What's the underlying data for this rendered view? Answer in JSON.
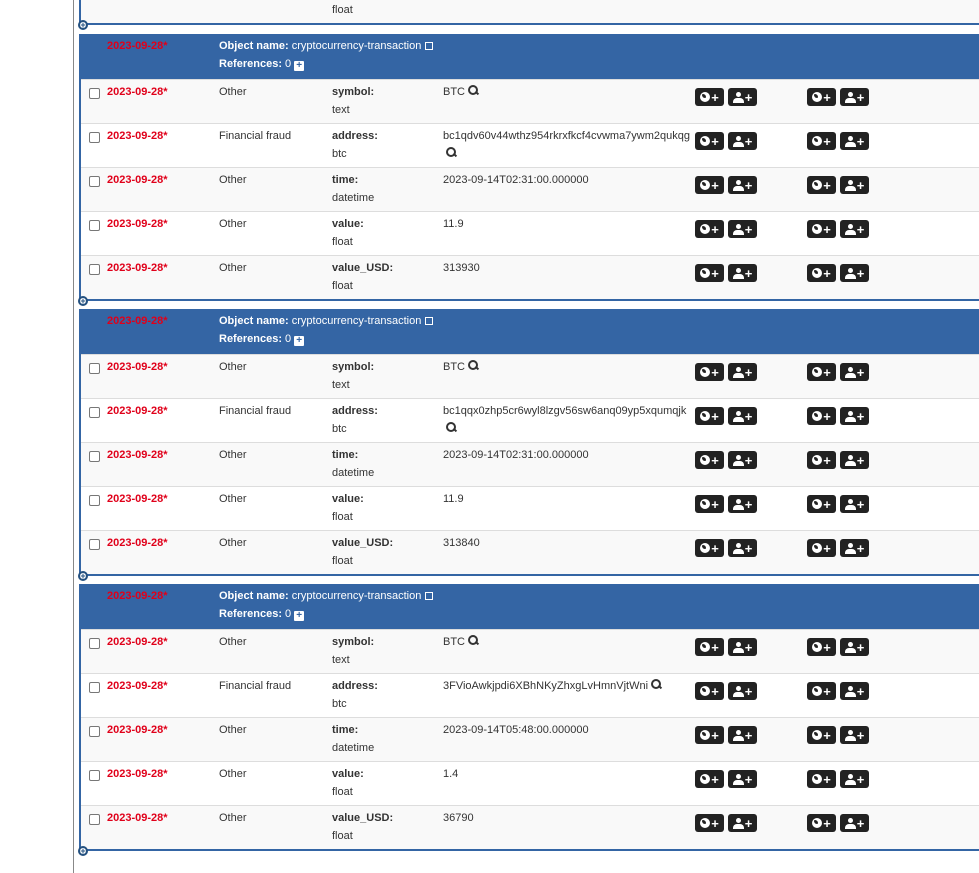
{
  "top_partial": {
    "type": "float"
  },
  "labels": {
    "object_name": "Object name:",
    "references": "References:"
  },
  "objects": [
    {
      "date": "2023-09-28*",
      "name": "cryptocurrency-transaction",
      "references": "0",
      "attributes": [
        {
          "date": "2023-09-28*",
          "category": "Other",
          "relation": "symbol:",
          "type": "text",
          "value": "BTC",
          "has_search": true
        },
        {
          "date": "2023-09-28*",
          "category": "Financial fraud",
          "relation": "address:",
          "type": "btc",
          "value": "bc1qdv60v44wthz954rkrxfkcf4cvwma7ywm2qukqg",
          "has_search": true
        },
        {
          "date": "2023-09-28*",
          "category": "Other",
          "relation": "time:",
          "type": "datetime",
          "value": "2023-09-14T02:31:00.000000",
          "has_search": false
        },
        {
          "date": "2023-09-28*",
          "category": "Other",
          "relation": "value:",
          "type": "float",
          "value": "11.9",
          "has_search": false
        },
        {
          "date": "2023-09-28*",
          "category": "Other",
          "relation": "value_USD:",
          "type": "float",
          "value": "313930",
          "has_search": false
        }
      ]
    },
    {
      "date": "2023-09-28*",
      "name": "cryptocurrency-transaction",
      "references": "0",
      "attributes": [
        {
          "date": "2023-09-28*",
          "category": "Other",
          "relation": "symbol:",
          "type": "text",
          "value": "BTC",
          "has_search": true
        },
        {
          "date": "2023-09-28*",
          "category": "Financial fraud",
          "relation": "address:",
          "type": "btc",
          "value": "bc1qqx0zhp5cr6wyl8lzgv56sw6anq09yp5xqumqjk",
          "has_search": true
        },
        {
          "date": "2023-09-28*",
          "category": "Other",
          "relation": "time:",
          "type": "datetime",
          "value": "2023-09-14T02:31:00.000000",
          "has_search": false
        },
        {
          "date": "2023-09-28*",
          "category": "Other",
          "relation": "value:",
          "type": "float",
          "value": "11.9",
          "has_search": false
        },
        {
          "date": "2023-09-28*",
          "category": "Other",
          "relation": "value_USD:",
          "type": "float",
          "value": "313840",
          "has_search": false
        }
      ]
    },
    {
      "date": "2023-09-28*",
      "name": "cryptocurrency-transaction",
      "references": "0",
      "attributes": [
        {
          "date": "2023-09-28*",
          "category": "Other",
          "relation": "symbol:",
          "type": "text",
          "value": "BTC",
          "has_search": true
        },
        {
          "date": "2023-09-28*",
          "category": "Financial fraud",
          "relation": "address:",
          "type": "btc",
          "value": "3FVioAwkjpdi6XBhNKyZhxgLvHmnVjtWni",
          "has_search": true
        },
        {
          "date": "2023-09-28*",
          "category": "Other",
          "relation": "time:",
          "type": "datetime",
          "value": "2023-09-14T05:48:00.000000",
          "has_search": false
        },
        {
          "date": "2023-09-28*",
          "category": "Other",
          "relation": "value:",
          "type": "float",
          "value": "1.4",
          "has_search": false
        },
        {
          "date": "2023-09-28*",
          "category": "Other",
          "relation": "value_USD:",
          "type": "float",
          "value": "36790",
          "has_search": false
        }
      ]
    }
  ],
  "colors": {
    "header_bg": "#3465a4",
    "date_red": "#e0001a",
    "button_dark": "#222222"
  }
}
